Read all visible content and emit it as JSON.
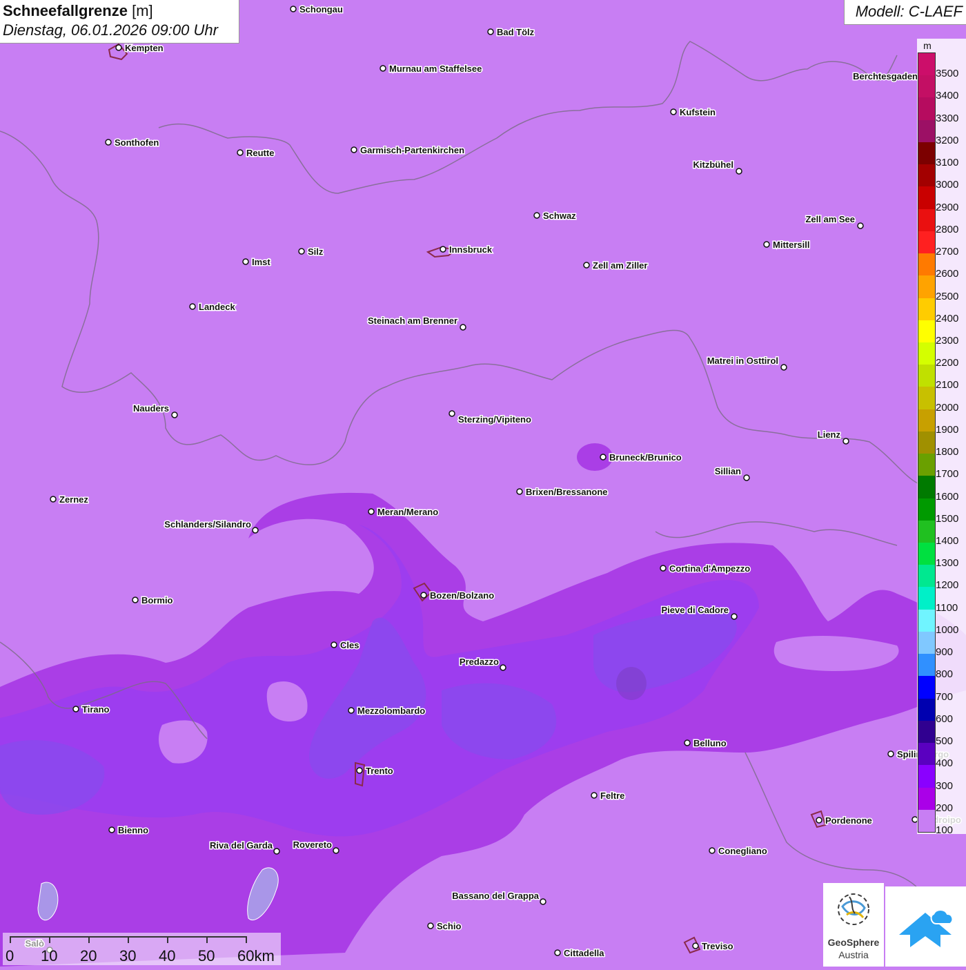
{
  "header": {
    "title": "Schneefallgrenze",
    "unit": "[m]",
    "datetime": "Dienstag, 06.01.2026 09:00 Uhr"
  },
  "model": {
    "label": "Modell: C-LAEF"
  },
  "legend": {
    "unit": "m",
    "levels": [
      {
        "label": "3500",
        "color": "#cc0e6a"
      },
      {
        "label": "3400",
        "color": "#c30f64"
      },
      {
        "label": "3300",
        "color": "#b60c5f"
      },
      {
        "label": "3200",
        "color": "#9c1065"
      },
      {
        "label": "3100",
        "color": "#7c0000"
      },
      {
        "label": "3000",
        "color": "#a30000"
      },
      {
        "label": "2900",
        "color": "#c90000"
      },
      {
        "label": "2800",
        "color": "#ea1010"
      },
      {
        "label": "2700",
        "color": "#ff2020"
      },
      {
        "label": "2600",
        "color": "#ff7a00"
      },
      {
        "label": "2500",
        "color": "#ffa300"
      },
      {
        "label": "2400",
        "color": "#ffcc00"
      },
      {
        "label": "2300",
        "color": "#ffff00"
      },
      {
        "label": "2200",
        "color": "#d4ff00"
      },
      {
        "label": "2100",
        "color": "#c0e000"
      },
      {
        "label": "2000",
        "color": "#c8c000"
      },
      {
        "label": "1900",
        "color": "#c8a000"
      },
      {
        "label": "1800",
        "color": "#a09000"
      },
      {
        "label": "1700",
        "color": "#6aa000"
      },
      {
        "label": "1600",
        "color": "#007a00"
      },
      {
        "label": "1500",
        "color": "#009a00"
      },
      {
        "label": "1400",
        "color": "#20c020"
      },
      {
        "label": "1300",
        "color": "#00e040"
      },
      {
        "label": "1200",
        "color": "#00e890"
      },
      {
        "label": "1100",
        "color": "#00f0c8"
      },
      {
        "label": "1000",
        "color": "#70f4ff"
      },
      {
        "label": "900",
        "color": "#80c8ff"
      },
      {
        "label": "800",
        "color": "#3090ff"
      },
      {
        "label": "700",
        "color": "#0000ff"
      },
      {
        "label": "600",
        "color": "#0000b0"
      },
      {
        "label": "500",
        "color": "#300090"
      },
      {
        "label": "400",
        "color": "#5a00c0"
      },
      {
        "label": "300",
        "color": "#8a00ff"
      },
      {
        "label": "200",
        "color": "#aa00e8"
      },
      {
        "label": "100",
        "color": "#c87ef3"
      }
    ]
  },
  "cities": [
    {
      "name": "Schongau"
    },
    {
      "name": "Bad Tölz"
    },
    {
      "name": "Kempten"
    },
    {
      "name": "Murnau am Staffelsee"
    },
    {
      "name": "Berchtesgaden"
    },
    {
      "name": "Kufstein"
    },
    {
      "name": "Sonthofen"
    },
    {
      "name": "Reutte"
    },
    {
      "name": "Garmisch-Partenkirchen"
    },
    {
      "name": "Kitzbühel"
    },
    {
      "name": "Schwaz"
    },
    {
      "name": "Zell am See"
    },
    {
      "name": "Mittersill"
    },
    {
      "name": "Innsbruck"
    },
    {
      "name": "Silz"
    },
    {
      "name": "Imst"
    },
    {
      "name": "Zell am Ziller"
    },
    {
      "name": "Landeck"
    },
    {
      "name": "Steinach am Brenner"
    },
    {
      "name": "Matrei in Osttirol"
    },
    {
      "name": "Nauders"
    },
    {
      "name": "Sterzing/Vipiteno"
    },
    {
      "name": "Lienz"
    },
    {
      "name": "Bruneck/Brunico"
    },
    {
      "name": "Sillian"
    },
    {
      "name": "Brixen/Bressanone"
    },
    {
      "name": "Zernez"
    },
    {
      "name": "Meran/Merano"
    },
    {
      "name": "Schlanders/Silandro"
    },
    {
      "name": "Cortina d'Ampezzo"
    },
    {
      "name": "Bozen/Bolzano"
    },
    {
      "name": "Bormio"
    },
    {
      "name": "Pieve di Cadore"
    },
    {
      "name": "Cles"
    },
    {
      "name": "Predazzo"
    },
    {
      "name": "Tirano"
    },
    {
      "name": "Mezzolombardo"
    },
    {
      "name": "Belluno"
    },
    {
      "name": "Spilimbergo"
    },
    {
      "name": "Trento"
    },
    {
      "name": "Feltre"
    },
    {
      "name": "Pordenone"
    },
    {
      "name": "Codroipo"
    },
    {
      "name": "Bienno"
    },
    {
      "name": "Riva del Garda"
    },
    {
      "name": "Rovereto"
    },
    {
      "name": "Conegliano"
    },
    {
      "name": "Bassano del Grappa"
    },
    {
      "name": "Schio"
    },
    {
      "name": "Treviso"
    },
    {
      "name": "Cittadella"
    },
    {
      "name": "Salò"
    }
  ],
  "scale_bar": {
    "labels": [
      "0",
      "10",
      "20",
      "30",
      "40",
      "50",
      "60km"
    ]
  },
  "logos": {
    "geosphere_name": "GeoSphere",
    "geosphere_country": "Austria",
    "app_icon": "cloud-arrow-icon"
  }
}
